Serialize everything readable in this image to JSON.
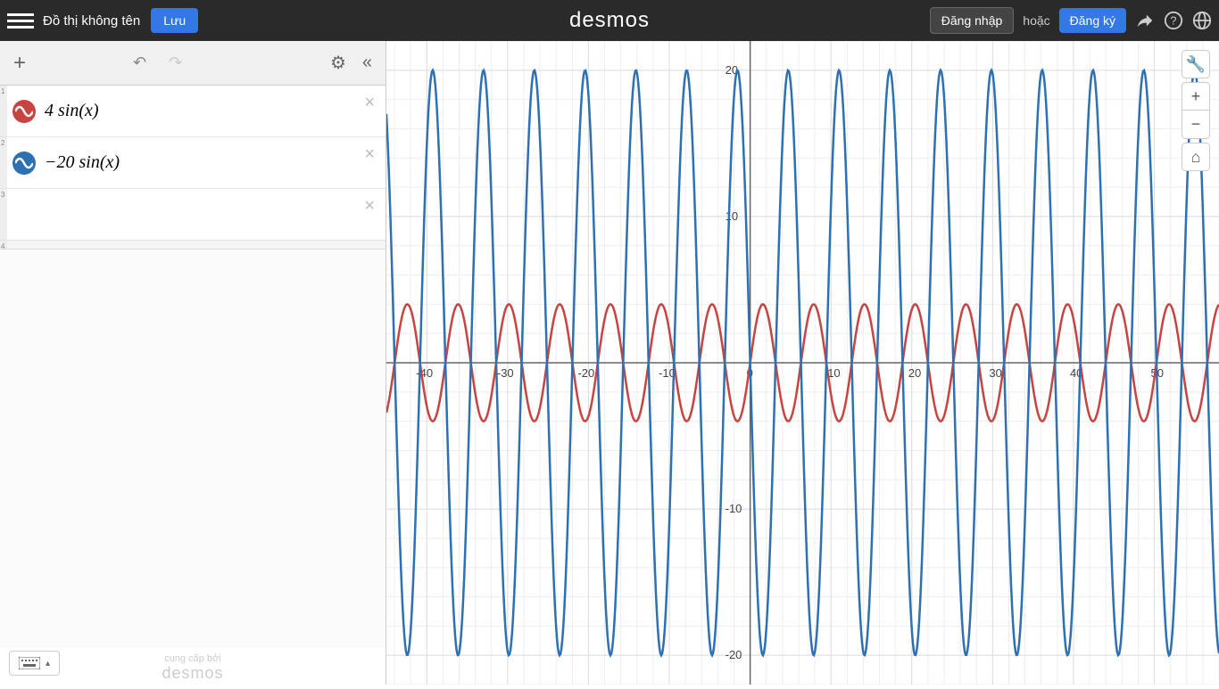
{
  "header": {
    "title": "Đồ thị không tên",
    "save": "Lưu",
    "brand": "desmos",
    "signin": "Đăng nhập",
    "or": "hoặc",
    "signup": "Đăng ký"
  },
  "expressions": [
    {
      "num": "1",
      "color": "red",
      "formula": "4 sin(x)"
    },
    {
      "num": "2",
      "color": "blue",
      "formula": "−20 sin(x)"
    },
    {
      "num": "3",
      "color": "",
      "formula": ""
    },
    {
      "num": "4",
      "color": "",
      "formula": ""
    }
  ],
  "attribution": {
    "by": "cung cấp bởi",
    "brand": "desmos"
  },
  "chart_data": {
    "type": "line",
    "x_range": [
      -45,
      58
    ],
    "y_range": [
      -22,
      22
    ],
    "x_ticks": [
      -40,
      -30,
      -20,
      -10,
      0,
      10,
      20,
      30,
      40,
      50
    ],
    "y_ticks": [
      -20,
      -10,
      0,
      10,
      20
    ],
    "series": [
      {
        "name": "4 sin(x)",
        "color": "#c74440",
        "amplitude": 4,
        "period": 6.2832
      },
      {
        "name": "-20 sin(x)",
        "color": "#2d70b3",
        "amplitude": -20,
        "period": 6.2832
      }
    ]
  }
}
